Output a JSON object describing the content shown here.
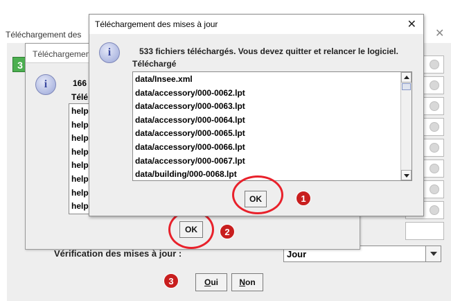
{
  "back_window": {
    "title": "Téléchargement des mises à jour",
    "tab_badge": "3",
    "verification_label": "Vérification des mises à jour :",
    "frequency_value": "Jour",
    "yes_label": "Oui",
    "yes_mnemonic": "O",
    "yes_rest": "ui",
    "no_label": "Non",
    "no_mnemonic": "N",
    "no_rest": "on"
  },
  "middle_window": {
    "title": "Téléchargement des mises à jour",
    "count_text": "166",
    "sub_label": "Télé",
    "list_items": [
      "help",
      "help",
      "help",
      "help",
      "help",
      "help",
      "help",
      "help"
    ],
    "ok_label": "OK"
  },
  "front_dialog": {
    "title": "Téléchargement des mises à jour",
    "message": "533 fichiers téléchargés. Vous devez quitter et relancer le logiciel.",
    "list_label": "Téléchargé",
    "files": [
      "data/Insee.xml",
      "data/accessory/000-0062.lpt",
      "data/accessory/000-0063.lpt",
      "data/accessory/000-0064.lpt",
      "data/accessory/000-0065.lpt",
      "data/accessory/000-0066.lpt",
      "data/accessory/000-0067.lpt",
      "data/building/000-0068.lpt"
    ],
    "ok_label": "OK",
    "close_glyph": "✕"
  },
  "annotations": {
    "step1": "1",
    "step2": "2",
    "step3": "3",
    "ring_color": "#e8212b",
    "badge_color": "#c81e1e"
  },
  "icons": {
    "info": "information-icon",
    "close": "close-icon",
    "dropdown": "chevron-down-icon"
  }
}
